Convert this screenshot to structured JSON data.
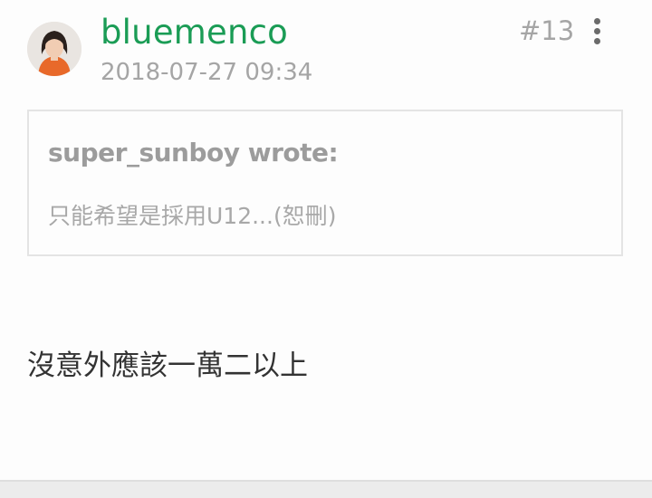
{
  "post": {
    "username": "bluemenco",
    "timestamp": "2018-07-27 09:34",
    "floor": "#13",
    "more_icon": "more-vertical-icon",
    "quote": {
      "author_line": "super_sunboy wrote:",
      "text": "只能希望是採用U12...(恕刪)"
    },
    "content": "沒意外應該一萬二以上"
  },
  "colors": {
    "username": "#1a9c55",
    "meta_text": "#a5a5a5",
    "body_text": "#333333",
    "quote_border": "#e4e4e4"
  }
}
